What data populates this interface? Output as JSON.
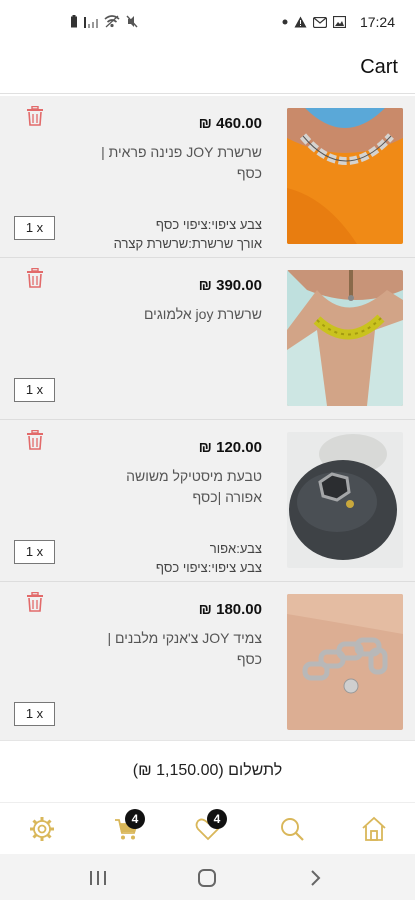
{
  "status_bar": {
    "time": "17:24",
    "left_icons": [
      "battery-icon",
      "signal-icon",
      "wifi-icon",
      "mute-icon"
    ],
    "right_icons": [
      "dot-icon",
      "alert-icon",
      "message-icon",
      "image-icon"
    ]
  },
  "header": {
    "title": "Cart"
  },
  "cart": {
    "items": [
      {
        "price": "460.00 ₪",
        "name": "שרשרת JOY פנינה פראית | כסף",
        "attr1": "צבע ציפוי:ציפוי כסף",
        "attr2": "אורך שרשרת:שרשרת קצרה",
        "qty": "1 x"
      },
      {
        "price": "390.00 ₪",
        "name": "שרשרת joy אלמוגים",
        "attr1": "",
        "attr2": "",
        "qty": "1 x"
      },
      {
        "price": "120.00 ₪",
        "name": "טבעת מיסטיקל משושה אפורה |כסף",
        "attr1": "צבע:אפור",
        "attr2": "צבע ציפוי:ציפוי כסף",
        "qty": "1 x"
      },
      {
        "price": "180.00 ₪",
        "name": "צמיד JOY צ'אנקי מלבנים | כסף",
        "attr1": "",
        "attr2": "",
        "qty": "1 x"
      }
    ]
  },
  "total": {
    "label": "לתשלום (1,150.00 ₪)"
  },
  "bottom_nav": {
    "items": [
      "settings-icon",
      "cart-icon",
      "heart-icon",
      "search-icon",
      "home-icon"
    ],
    "cart_badge": "4",
    "wishlist_badge": "4",
    "accent_color": "#d9b75a"
  },
  "system_nav": {
    "buttons": [
      "recents-button",
      "home-button",
      "back-button"
    ]
  }
}
